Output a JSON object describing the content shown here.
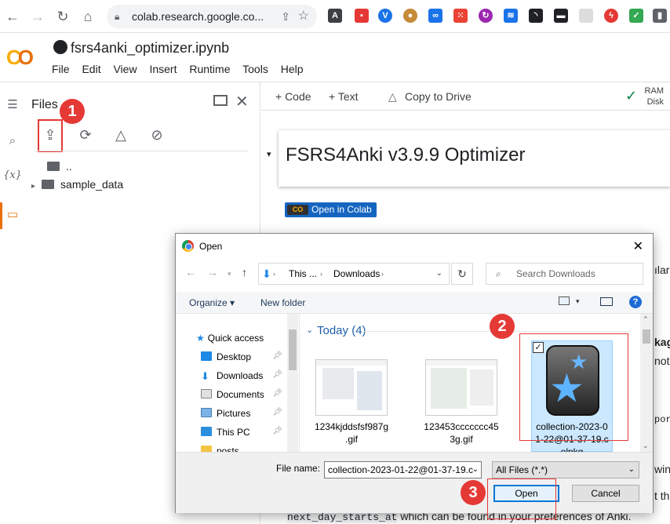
{
  "browser": {
    "url": "colab.research.google.co..."
  },
  "colab": {
    "notebook_title": "fsrs4anki_optimizer.ipynb",
    "menu": [
      "File",
      "Edit",
      "View",
      "Insert",
      "Runtime",
      "Tools",
      "Help"
    ],
    "toolbar": {
      "code": "+ Code",
      "text": "+ Text",
      "copy": "Copy to Drive",
      "ram": "RAM",
      "disk": "Disk"
    },
    "files": {
      "title": "Files",
      "items": [
        {
          "name": ".."
        },
        {
          "name": "sample_data"
        }
      ]
    },
    "cell_title": "FSRS4Anki v3.9.9 Optimizer",
    "open_in_colab": "Open in Colab",
    "bg_fragments": {
      "r1": "ılar",
      "r2": "kag",
      "r3": "not",
      "r4": "por",
      "r5": "win",
      "r6": "t th"
    },
    "code_line": {
      "code": "next_day_starts_at",
      "rest": " which can be found in your preferences of Anki."
    }
  },
  "badges": {
    "one": "1",
    "two": "2",
    "three": "3"
  },
  "dialog": {
    "title": "Open",
    "breadcrumb": [
      "This ...",
      "Downloads"
    ],
    "search_placeholder": "Search Downloads",
    "organize": "Organize",
    "new_folder": "New folder",
    "nav_items": [
      "Quick access",
      "Desktop",
      "Downloads",
      "Documents",
      "Pictures",
      "This PC",
      "posts"
    ],
    "group": "Today (4)",
    "files": [
      {
        "name1": "1234kjddsfsf987g",
        "name2": ".gif"
      },
      {
        "name1": "123453ccccccc45",
        "name2": "3g.gif"
      },
      {
        "name1": "collection-2023-0",
        "name2": "1-22@01-37-19.c",
        "name3": "olpkg"
      }
    ],
    "file_name_label": "File name:",
    "file_name_value": "collection-2023-01-22@01-37-19.c",
    "filter": "All Files (*.*)",
    "open_button": "Open",
    "cancel_button": "Cancel"
  }
}
